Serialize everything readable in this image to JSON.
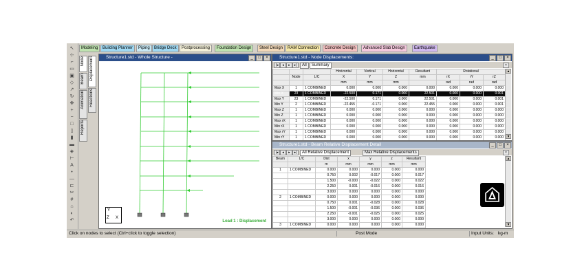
{
  "mode_tabs": [
    {
      "label": "Modeling",
      "color": "#bfe3b0"
    },
    {
      "label": "Building Planner",
      "color": "#9fd8f2"
    },
    {
      "label": "Piping",
      "color": "#c8e8f4"
    },
    {
      "label": "Bridge Deck",
      "color": "#9fd8f2"
    },
    {
      "label": "Postprocessing",
      "color": "#f4f0d8"
    },
    {
      "label": "Foundation Design",
      "color": "#bfe3b0"
    },
    {
      "label": "Steel Design",
      "color": "#f2d8b8"
    },
    {
      "label": "RAM Connection",
      "color": "#f4e6a8"
    },
    {
      "label": "Concrete Design",
      "color": "#f4c0c0"
    },
    {
      "label": "Advanced Slab Design",
      "color": "#f4c8dc"
    },
    {
      "label": "Earthquake",
      "color": "#d0b8ee"
    }
  ],
  "side_tabs": {
    "node": "Node",
    "beam": "Beam",
    "animation": "Animation",
    "reports": "Reports",
    "displacement": "Displacement",
    "reactions": "Reactions"
  },
  "structure_window": {
    "title": "Structure1.std - Whole Structure -",
    "load_label": "Load 1 : Displacement",
    "axis_y": "Y",
    "axis_x": "X",
    "axis_z": "Z",
    "colors": {
      "structure": "#33cc33",
      "load": "#33cc33",
      "support": "#555555"
    }
  },
  "node_window": {
    "title": "Structure1.std - Node Displacements:",
    "tabs": [
      "All",
      "Summary"
    ],
    "group_headers": {
      "horizontal": "Horizontal",
      "vertical": "Vertical",
      "horizontal2": "Horizontal",
      "resultant": "Resultant",
      "rotational": "Rotational"
    },
    "col_headers": {
      "node": "Node",
      "lc": "L/C",
      "x": "X",
      "y": "Y",
      "z": "Z",
      "rx": "rX",
      "ry": "rY",
      "rz": "rZ"
    },
    "units": {
      "mm": "mm",
      "rad": "rad"
    },
    "rows": [
      {
        "label": "Max X",
        "node": "1",
        "lc": "1 COMBINED",
        "x": "0.000",
        "y": "0.000",
        "z": "0.000",
        "res": "0.000",
        "rx": "0.000",
        "ry": "0.000",
        "rz": "0.000"
      },
      {
        "label": "Min X",
        "node": "23",
        "lc": "1 COMBINED",
        "x": "-22.500",
        "y": "0.171",
        "z": "0.000",
        "res": "22.501",
        "rx": "0.000",
        "ry": "0.000",
        "rz": "0.001"
      },
      {
        "label": "Max Y",
        "node": "23",
        "lc": "1 COMBINED",
        "x": "-22.500",
        "y": "0.171",
        "z": "0.000",
        "res": "22.501",
        "rx": "0.000",
        "ry": "0.000",
        "rz": "0.001"
      },
      {
        "label": "Min Y",
        "node": "2",
        "lc": "1 COMBINED",
        "x": "-22.455",
        "y": "-0.171",
        "z": "0.000",
        "res": "22.455",
        "rx": "0.000",
        "ry": "0.000",
        "rz": "0.001"
      },
      {
        "label": "Max Z",
        "node": "1",
        "lc": "1 COMBINED",
        "x": "0.000",
        "y": "0.000",
        "z": "0.000",
        "res": "0.000",
        "rx": "0.000",
        "ry": "0.000",
        "rz": "0.000"
      },
      {
        "label": "Min Z",
        "node": "1",
        "lc": "1 COMBINED",
        "x": "0.000",
        "y": "0.000",
        "z": "0.000",
        "res": "0.000",
        "rx": "0.000",
        "ry": "0.000",
        "rz": "0.000"
      },
      {
        "label": "Max rX",
        "node": "1",
        "lc": "1 COMBINED",
        "x": "0.000",
        "y": "0.000",
        "z": "0.000",
        "res": "0.000",
        "rx": "0.000",
        "ry": "0.000",
        "rz": "0.000"
      },
      {
        "label": "Min rX",
        "node": "1",
        "lc": "1 COMBINED",
        "x": "0.000",
        "y": "0.000",
        "z": "0.000",
        "res": "0.000",
        "rx": "0.000",
        "ry": "0.000",
        "rz": "0.000"
      },
      {
        "label": "Max rY",
        "node": "1",
        "lc": "1 COMBINED",
        "x": "0.000",
        "y": "0.000",
        "z": "0.000",
        "res": "0.000",
        "rx": "0.000",
        "ry": "0.000",
        "rz": "0.000"
      },
      {
        "label": "Min rY",
        "node": "1",
        "lc": "1 COMBINED",
        "x": "0.000",
        "y": "0.000",
        "z": "0.000",
        "res": "0.000",
        "rx": "0.000",
        "ry": "0.000",
        "rz": "0.000"
      }
    ]
  },
  "beam_window": {
    "title": "Structure1.std - Beam Relative Displacement Detail",
    "tabs": [
      "All Relative Displacement",
      "Max Relative Displacements"
    ],
    "col_headers": {
      "beam": "Beam",
      "lc": "L/C",
      "dist": "Dist",
      "x": "x",
      "y": "y",
      "z": "z",
      "res": "Resultant"
    },
    "units": {
      "m": "m",
      "mm": "mm"
    },
    "rows": [
      {
        "beam": "1",
        "lc": "1 COMBINED",
        "dist": "0.000",
        "x": "0.000",
        "y": "0.000",
        "z": "0.000",
        "res": "0.000"
      },
      {
        "beam": "",
        "lc": "",
        "dist": "0.750",
        "x": "0.002",
        "y": "-0.017",
        "z": "0.000",
        "res": "0.017"
      },
      {
        "beam": "",
        "lc": "",
        "dist": "1.500",
        "x": "-0.000",
        "y": "-0.022",
        "z": "0.000",
        "res": "0.022"
      },
      {
        "beam": "",
        "lc": "",
        "dist": "2.250",
        "x": "0.001",
        "y": "-0.016",
        "z": "0.000",
        "res": "0.016"
      },
      {
        "beam": "",
        "lc": "",
        "dist": "3.000",
        "x": "0.000",
        "y": "0.000",
        "z": "0.000",
        "res": "0.000"
      },
      {
        "beam": "2",
        "lc": "1 COMBINED",
        "dist": "0.000",
        "x": "0.000",
        "y": "0.000",
        "z": "0.000",
        "res": "0.000"
      },
      {
        "beam": "",
        "lc": "",
        "dist": "0.750",
        "x": "0.001",
        "y": "-0.028",
        "z": "0.000",
        "res": "0.028"
      },
      {
        "beam": "",
        "lc": "",
        "dist": "1.500",
        "x": "-0.001",
        "y": "-0.036",
        "z": "0.000",
        "res": "0.036"
      },
      {
        "beam": "",
        "lc": "",
        "dist": "2.250",
        "x": "-0.001",
        "y": "-0.025",
        "z": "0.000",
        "res": "0.025"
      },
      {
        "beam": "",
        "lc": "",
        "dist": "3.000",
        "x": "0.000",
        "y": "0.000",
        "z": "0.000",
        "res": "0.000"
      },
      {
        "beam": "3",
        "lc": "1 COMBINED",
        "dist": "0.000",
        "x": "0.000",
        "y": "0.000",
        "z": "0.000",
        "res": "0.000"
      }
    ]
  },
  "status_bar": {
    "hint": "Click on nodes to select (Ctrl+click to toggle selection)",
    "mode": "Post Mode",
    "units_label": "Input Units:",
    "units_value": "kg-m"
  }
}
